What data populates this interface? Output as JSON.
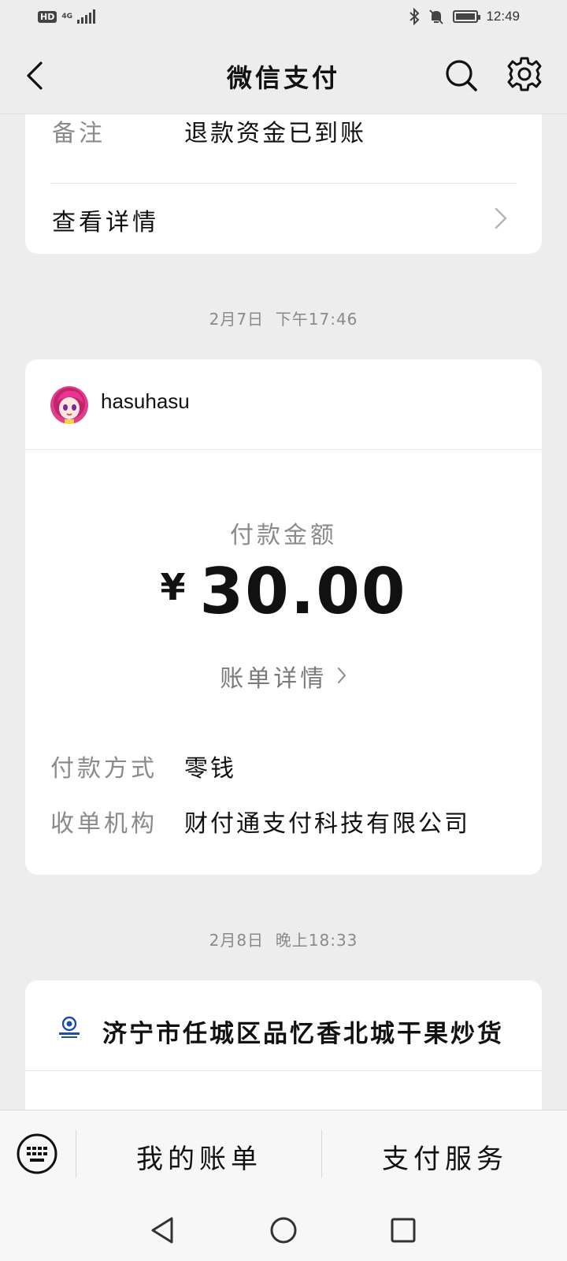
{
  "status_bar": {
    "hd": "HD",
    "network": "4G",
    "time": "12:49"
  },
  "header": {
    "title": "微信支付",
    "back_icon": "chevron-left-icon",
    "search_icon": "search-icon",
    "settings_icon": "gear-icon"
  },
  "card_refund": {
    "remark_label": "备注",
    "remark_value": "退款资金已到账",
    "details_link": "查看详情"
  },
  "transaction_1": {
    "date": "2月7日",
    "time": "下午17:46",
    "merchant": "hasuhasu",
    "amount_label": "付款金额",
    "currency": "¥",
    "amount": "30.00",
    "bill_details_link": "账单详情",
    "payment_method_label": "付款方式",
    "payment_method_value": "零钱",
    "acquirer_label": "收单机构",
    "acquirer_value": "财付通支付科技有限公司"
  },
  "transaction_2": {
    "date": "2月8日",
    "time": "晚上18:33",
    "merchant": "济宁市任城区品忆香北城干果炒货"
  },
  "bottom_menu": {
    "keyboard_icon": "keyboard-icon",
    "my_bills": "我的账单",
    "pay_services": "支付服务"
  },
  "colors": {
    "background": "#ededed",
    "card": "#ffffff",
    "muted_text": "#8a8a8a"
  }
}
